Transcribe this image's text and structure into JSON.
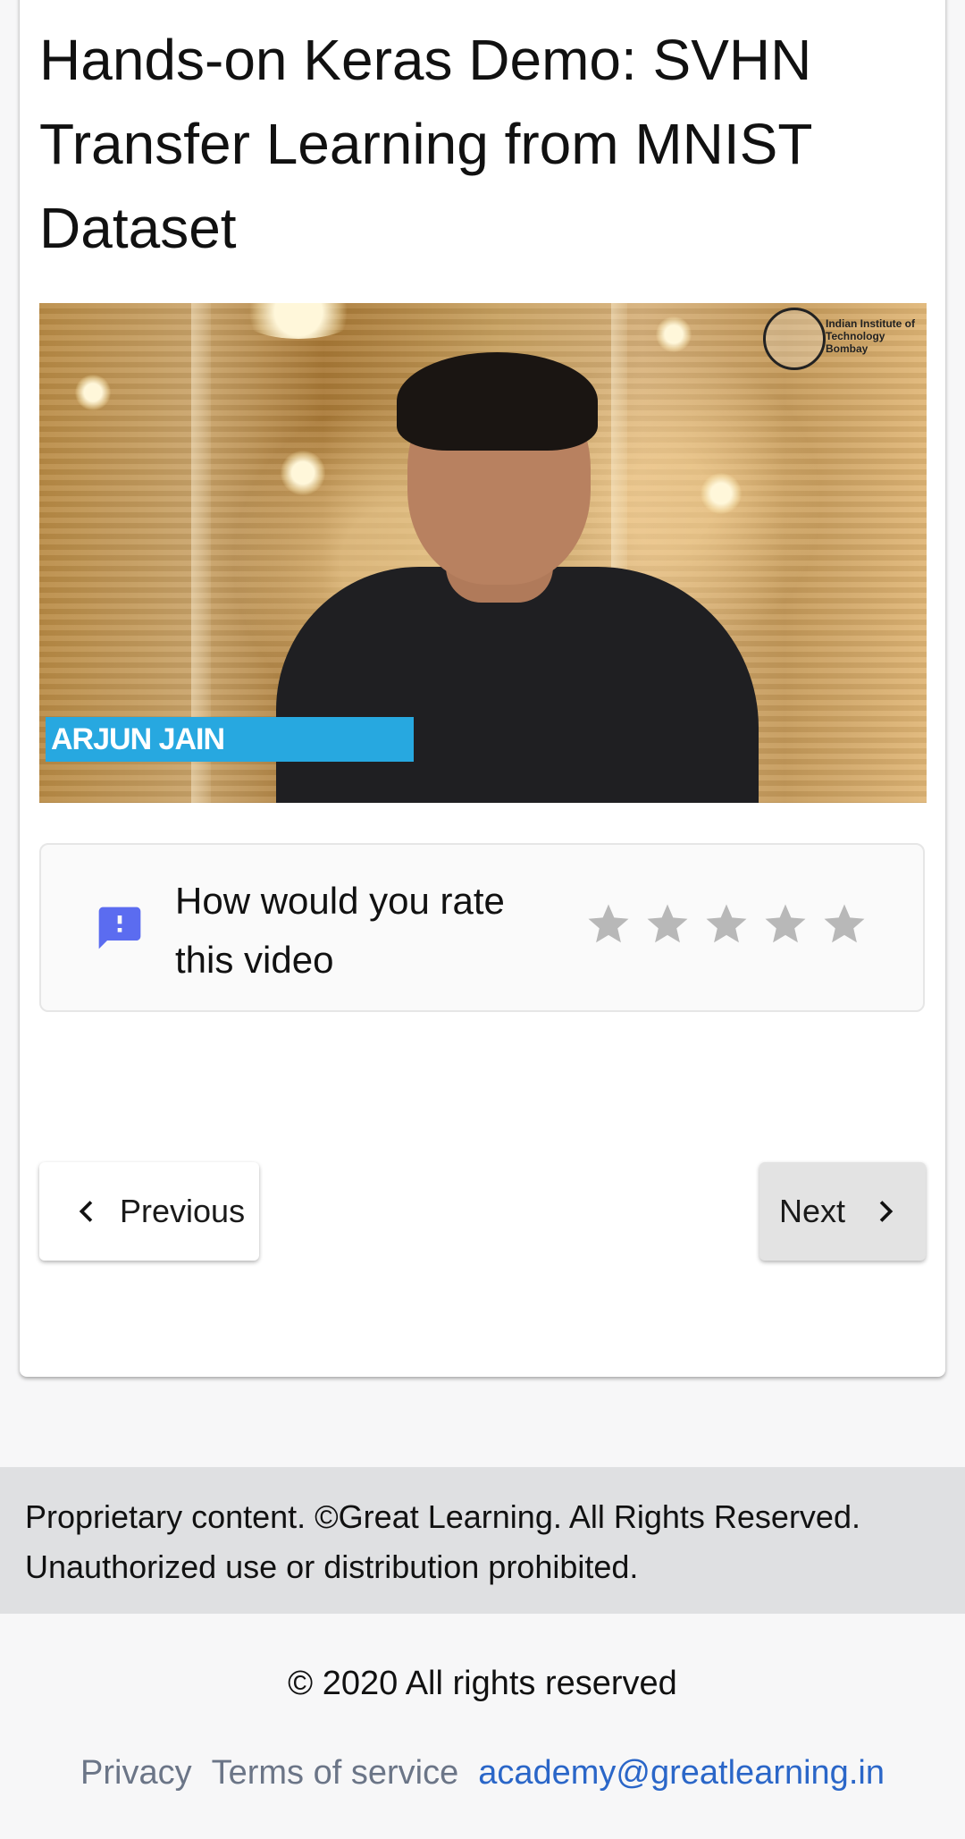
{
  "page": {
    "title": "Hands-on Keras Demo: SVHN Transfer Learning from MNIST Dataset"
  },
  "video": {
    "lower_third_name": "ARJUN JAIN",
    "logo_text": "Indian Institute of Technology Bombay"
  },
  "rating": {
    "icon": "feedback-icon",
    "prompt": "How would you rate this video",
    "max_stars": 5,
    "current_rating": 0,
    "star_color": "#b8b8b8",
    "icon_color": "#5b6cf0"
  },
  "navigation": {
    "previous_label": "Previous",
    "next_label": "Next"
  },
  "footer": {
    "notice": "Proprietary content. ©Great Learning. All Rights Reserved. Unauthorized use or distribution prohibited.",
    "copyright": "© 2020 All rights reserved",
    "links": {
      "privacy": "Privacy",
      "terms": "Terms of service",
      "email": "academy@greatlearning.in"
    }
  },
  "colors": {
    "lower_third_bg": "#27a8e0",
    "link_blue": "#2a66c8",
    "link_muted": "#6b7587"
  }
}
